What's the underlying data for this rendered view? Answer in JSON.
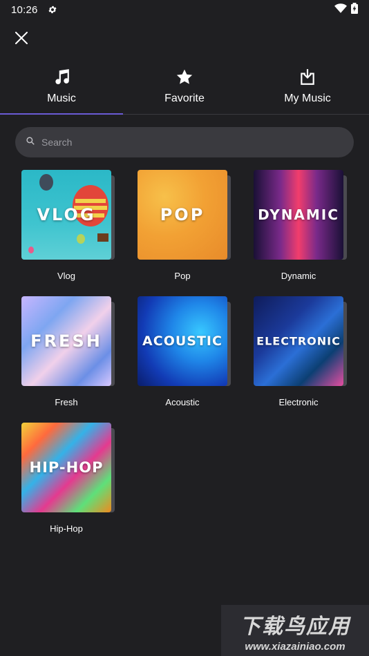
{
  "status_bar": {
    "time": "10:26",
    "icons": [
      "settings-gear-icon",
      "wifi-icon",
      "battery-icon"
    ]
  },
  "header": {
    "close_icon": "close-icon"
  },
  "tabs": [
    {
      "label": "Music",
      "icon": "music-note-icon",
      "active": true
    },
    {
      "label": "Favorite",
      "icon": "star-icon",
      "active": false
    },
    {
      "label": "My Music",
      "icon": "download-box-icon",
      "active": false
    }
  ],
  "search": {
    "placeholder": "Search",
    "value": ""
  },
  "categories": [
    {
      "title": "VLOG",
      "label": "Vlog"
    },
    {
      "title": "POP",
      "label": "Pop"
    },
    {
      "title": "DYNAMIC",
      "label": "Dynamic"
    },
    {
      "title": "FRESH",
      "label": "Fresh"
    },
    {
      "title": "ACOUSTIC",
      "label": "Acoustic"
    },
    {
      "title": "ELECTRONIC",
      "label": "Electronic"
    },
    {
      "title": "HIP-HOP",
      "label": "Hip-Hop"
    }
  ],
  "watermark": {
    "chinese": "下载鸟应用",
    "url": "www.xiazainiao.com"
  },
  "colors": {
    "background": "#1f1f22",
    "search_bg": "#3a3a3f",
    "tab_indicator": "#6b5bd6"
  }
}
